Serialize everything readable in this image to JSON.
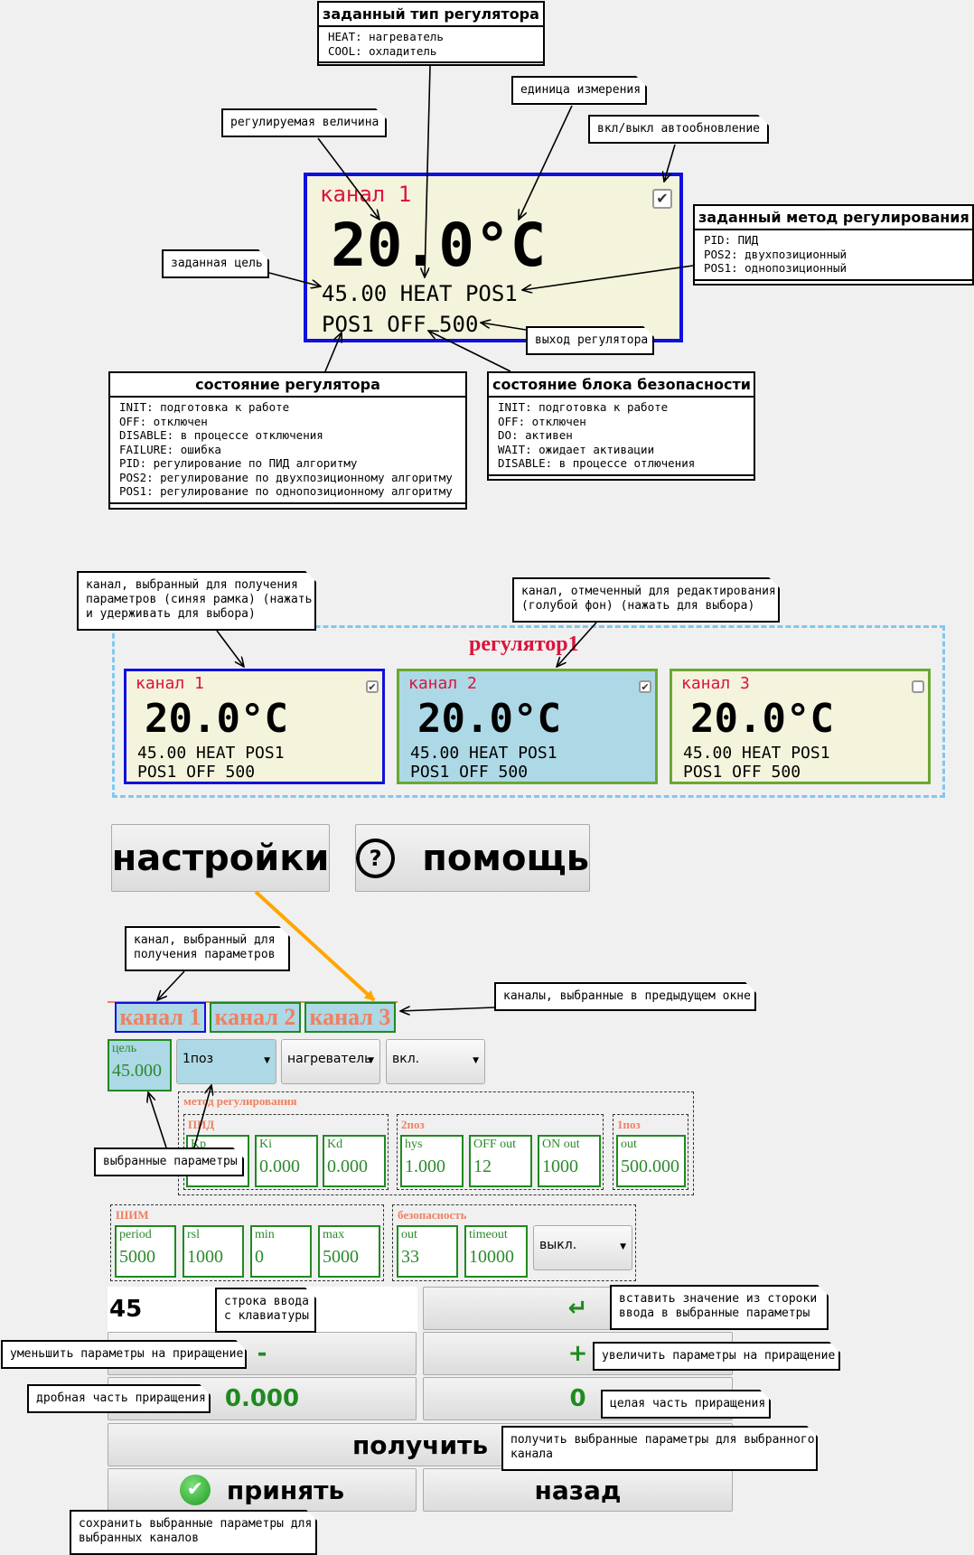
{
  "top_card": {
    "title": "канал 1",
    "temperature": "20.0°C",
    "line1": "45.00 HEAT POS1",
    "line2": "POS1 OFF 500"
  },
  "boxes": {
    "regulator_type": {
      "title": "заданный тип регулятора",
      "body": "HEAT: нагреватель\nCOOL: охладитель"
    },
    "regulation_method": {
      "title": "заданный метод регулирования",
      "body": "PID: ПИД\nPOS2: двухпозиционный\nPOS1: однопозиционный"
    },
    "regulator_state": {
      "title": "состояние регулятора",
      "body": "INIT: подготовка к работе\nOFF: отключен\nDISABLE: в процессе отключения\nFAILURE: ошибка\nPID: регулирование по ПИД алгоритму\nPOS2: регулирование по двухпозиционному алгоритму\nPOS1: регулирование по однопозиционному алгоритму"
    },
    "safety_state": {
      "title": "состояние блока безопасности",
      "body": "INIT: подготовка к работе\nOFF: отключен\nDO: активен\nWAIT: ожидает активации\nDISABLE: в процессе отлючения"
    }
  },
  "notes": {
    "controlled_value": "регулируемая величина",
    "unit": "единица измерения",
    "autoupdate": "вкл/выкл автообновление",
    "target": "заданная цель",
    "output": "выход регулятора",
    "channel_selected": "канал, выбранный для получения\nпараметров (синяя рамка) (нажать\nи удерживать для выбора)",
    "channel_marked": "канал, отмеченный для редактирования\n(голубой фон) (нажать для выбора)",
    "channel_params": "канал, выбранный для\nполучения параметров",
    "channels_prev": "каналы, выбранные в предыдущем окне",
    "selected_params": "выбранные параметры",
    "input_line": "строка ввода\nс клавиатуры",
    "insert_value": "вставить значение из стороки\nввода в выбранные параметры",
    "decrease": "уменьшить параметры на приращение",
    "increase": "увеличить параметры на приращение",
    "fraction": "дробная часть приращения",
    "integer": "целая часть приращения",
    "get_params": "получить выбранные параметры для выбранного\nканала",
    "save_params": "сохранить выбранные параметры для\nвыбранных каналов"
  },
  "regulator": {
    "name": "регулятор1",
    "channels": [
      {
        "title": "канал 1",
        "temperature": "20.0°C",
        "line1": "45.00 HEAT POS1",
        "line2": "POS1 OFF 500",
        "checked": true
      },
      {
        "title": "канал 2",
        "temperature": "20.0°C",
        "line1": "45.00 HEAT POS1",
        "line2": "POS1 OFF 500",
        "checked": true
      },
      {
        "title": "канал 3",
        "temperature": "20.0°C",
        "line1": "45.00 HEAT POS1",
        "line2": "POS1 OFF 500",
        "checked": false
      }
    ]
  },
  "buttons": {
    "settings": "настройки",
    "help": "помощь",
    "help_icon": "?",
    "enter": "↵",
    "minus": "-",
    "plus": "+",
    "fraction_value": "0.000",
    "integer_value": "0",
    "get": "получить",
    "accept": "принять",
    "back": "назад"
  },
  "editor": {
    "channel_tabs": [
      "канал 1",
      "канал 2",
      "канал 3"
    ],
    "target_label": "цель",
    "target_value": "45.000",
    "mode_select": "1поз",
    "type_select": "нагреватель",
    "enable_select": "вкл.",
    "method_group": "метод регулирования",
    "pid_group": "ПИД",
    "pos2_group": "2поз",
    "pos1_group": "1поз",
    "pid_fields": [
      {
        "label": "Kp",
        "value": ""
      },
      {
        "label": "Ki",
        "value": "0.000"
      },
      {
        "label": "Kd",
        "value": "0.000"
      }
    ],
    "pos2_fields": [
      {
        "label": "hys",
        "value": "1.000"
      },
      {
        "label": "OFF out",
        "value": "12"
      },
      {
        "label": "ON out",
        "value": "1000"
      }
    ],
    "pos1_fields": [
      {
        "label": "out",
        "value": "500.000"
      }
    ],
    "pwm_group": "ШИМ",
    "pwm_fields": [
      {
        "label": "period",
        "value": "5000"
      },
      {
        "label": "rsl",
        "value": "1000"
      },
      {
        "label": "min",
        "value": "0"
      },
      {
        "label": "max",
        "value": "5000"
      }
    ],
    "safety_group": "безопасность",
    "safety_fields": [
      {
        "label": "out",
        "value": "33"
      },
      {
        "label": "timeout",
        "value": "10000"
      }
    ],
    "safety_select": "выкл.",
    "input_value": "45"
  },
  "colors": {
    "accent_red": "#dc143c",
    "selected_border": "#0000dd",
    "marked_bg": "#add8e6",
    "green": "#1f8a1f",
    "orange": "#ffa500"
  }
}
